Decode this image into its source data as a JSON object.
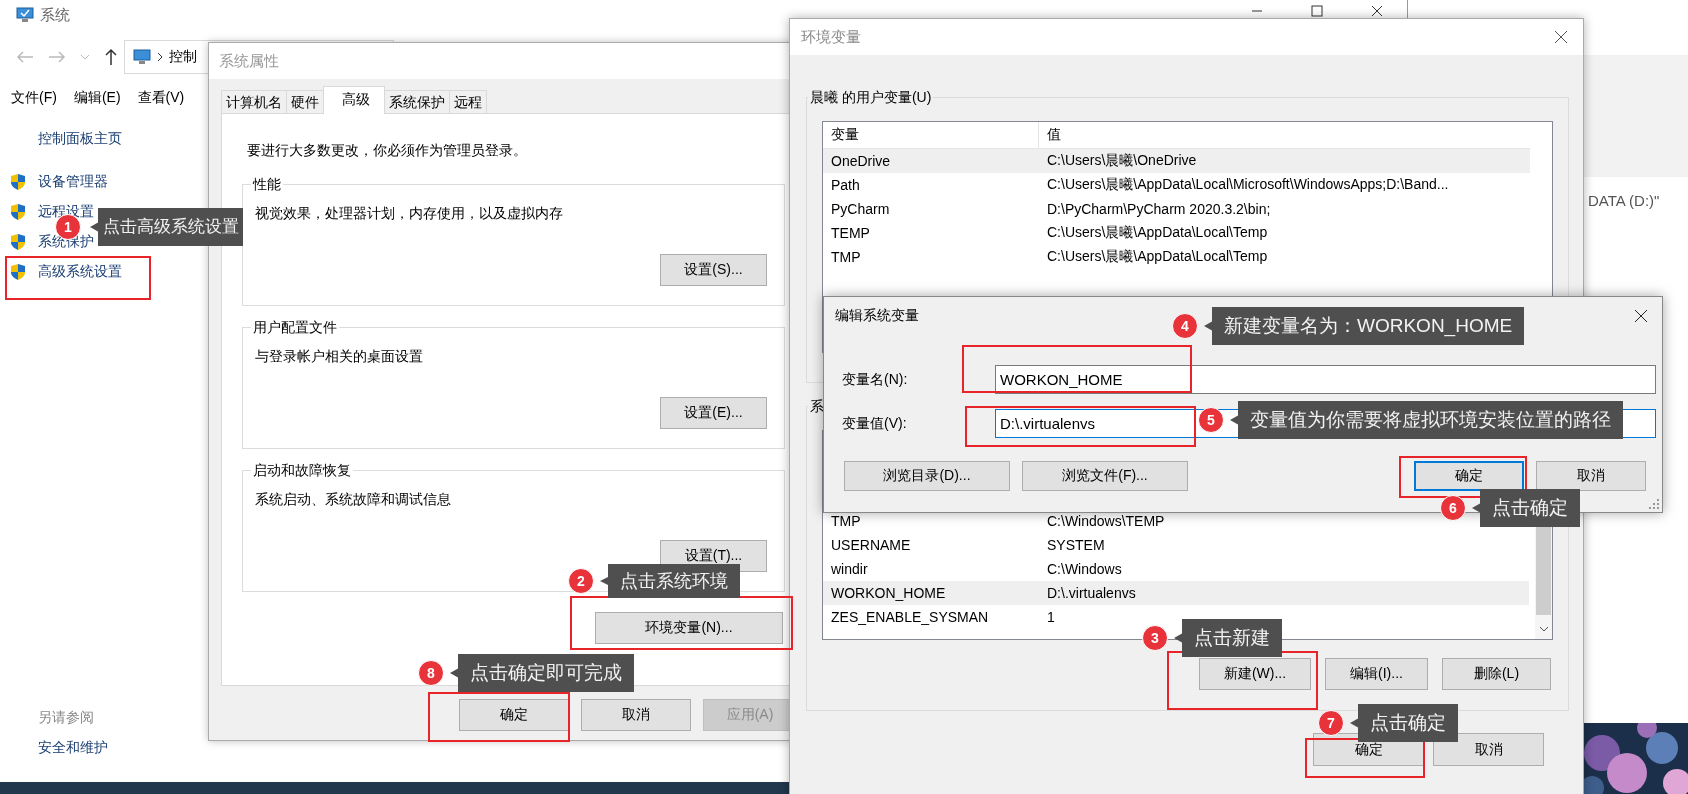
{
  "control_panel": {
    "title": "系统",
    "address": "控制",
    "menu": [
      "文件(F)",
      "编辑(E)",
      "查看(V)"
    ],
    "home_link": "控制面板主页",
    "tasks": [
      "设备管理器",
      "远程设置",
      "系统保护",
      "高级系统设置"
    ],
    "see_also_heading": "另请参阅",
    "see_also_links": [
      "安全和维护"
    ]
  },
  "background_window": {
    "text": "DATA (D:)\""
  },
  "system_properties": {
    "title": "系统属性",
    "tabs": [
      {
        "label": "计算机名",
        "selected": false
      },
      {
        "label": "硬件",
        "selected": false
      },
      {
        "label": "高级",
        "selected": true
      },
      {
        "label": "系统保护",
        "selected": false
      },
      {
        "label": "远程",
        "selected": false
      }
    ],
    "admin_note": "要进行大多数更改，你必须作为管理员登录。",
    "groups": [
      {
        "title": "性能",
        "description": "视觉效果，处理器计划，内存使用，以及虚拟内存",
        "button": "设置(S)..."
      },
      {
        "title": "用户配置文件",
        "description": "与登录帐户相关的桌面设置",
        "button": "设置(E)..."
      },
      {
        "title": "启动和故障恢复",
        "description": "系统启动、系统故障和调试信息",
        "button": "设置(T)..."
      }
    ],
    "env_button": "环境变量(N)...",
    "buttons": [
      {
        "label": "确定",
        "disabled": false
      },
      {
        "label": "取消",
        "disabled": false
      },
      {
        "label": "应用(A)",
        "disabled": true
      }
    ]
  },
  "environment_variables": {
    "title": "环境变量",
    "user_group": "晨曦 的用户变量(U)",
    "user_table": {
      "columns": [
        "变量",
        "值"
      ],
      "rows": [
        {
          "name": "OneDrive",
          "value": "C:\\Users\\晨曦\\OneDrive",
          "selected": true
        },
        {
          "name": "Path",
          "value": "C:\\Users\\晨曦\\AppData\\Local\\Microsoft\\WindowsApps;D:\\Band...",
          "selected": false
        },
        {
          "name": "PyCharm",
          "value": "D:\\PyCharm\\PyCharm 2020.3.2\\bin;",
          "selected": false
        },
        {
          "name": "TEMP",
          "value": "C:\\Users\\晨曦\\AppData\\Local\\Temp",
          "selected": false
        },
        {
          "name": "TMP",
          "value": "C:\\Users\\晨曦\\AppData\\Local\\Temp",
          "selected": false
        }
      ]
    },
    "system_group": "系",
    "system_table": {
      "rows": [
        {
          "name": "TMP",
          "value": "C:\\Windows\\TEMP",
          "selected": false
        },
        {
          "name": "USERNAME",
          "value": "SYSTEM",
          "selected": false
        },
        {
          "name": "windir",
          "value": "C:\\Windows",
          "selected": false
        },
        {
          "name": "WORKON_HOME",
          "value": "D:\\.virtualenvs",
          "selected": true
        },
        {
          "name": "ZES_ENABLE_SYSMAN",
          "value": "1",
          "selected": false
        }
      ]
    },
    "system_buttons": [
      "新建(W)...",
      "编辑(I)...",
      "删除(L)"
    ],
    "buttons": [
      "确定",
      "取消"
    ]
  },
  "edit_dialog": {
    "title": "编辑系统变量",
    "fields": [
      {
        "label": "变量名(N):",
        "value": "WORKON_HOME",
        "focused": false
      },
      {
        "label": "变量值(V):",
        "value": "D:\\.virtualenvs",
        "focused": true
      }
    ],
    "browse_buttons": [
      "浏览目录(D)...",
      "浏览文件(F)..."
    ],
    "buttons": [
      {
        "label": "确定",
        "default": true
      },
      {
        "label": "取消",
        "default": false
      }
    ]
  },
  "annotations": [
    {
      "number": "1",
      "text": "点击高级系统设置"
    },
    {
      "number": "4",
      "text": "新建变量名为：WORKON_HOME"
    },
    {
      "number": "5",
      "text": "变量值为你需要将虚拟环境安装位置的路径"
    },
    {
      "number": "6",
      "text": "点击确定"
    },
    {
      "number": "2",
      "text": "点击系统环境"
    },
    {
      "number": "3",
      "text": "点击新建"
    },
    {
      "number": "8",
      "text": "点击确定即可完成"
    },
    {
      "number": "7",
      "text": "点击确定"
    }
  ]
}
